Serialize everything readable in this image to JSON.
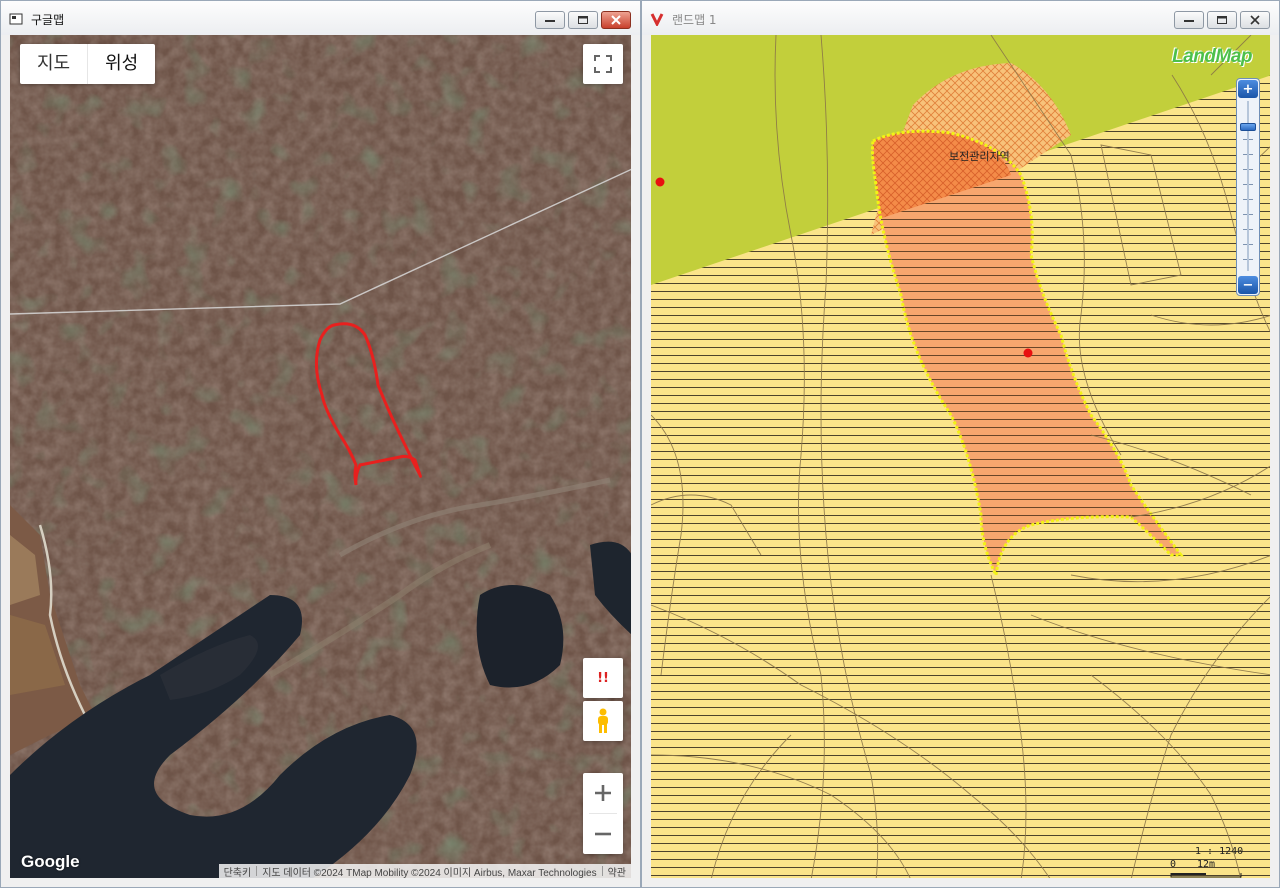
{
  "left_window": {
    "title": "구글맵",
    "map_type": [
      "지도",
      "위성"
    ],
    "google_logo": "Google",
    "attribution": [
      "단축키",
      "지도 데이터 ©2024 TMap Mobility ©2024 이미지 Airbus, Maxar Technologies",
      "약관"
    ],
    "pegman_alert": "!!"
  },
  "right_window": {
    "title": "랜드맵 1",
    "logo": "LandMap",
    "zone_label": "보전관리지역",
    "scale_ratio": "1 : 1240",
    "scale_zero": "0",
    "scale_distance": "12m",
    "zoom_plus": "+",
    "zoom_minus": "−"
  },
  "colors": {
    "parcel_outline": "#e8201e",
    "landmap_conservation_green": "#c2cf3b",
    "landmap_farmland_yellow": "#fbe48a",
    "landmap_parcel_orange": "#f7a66e",
    "landmap_boundary_yellow": "#f3f315"
  }
}
